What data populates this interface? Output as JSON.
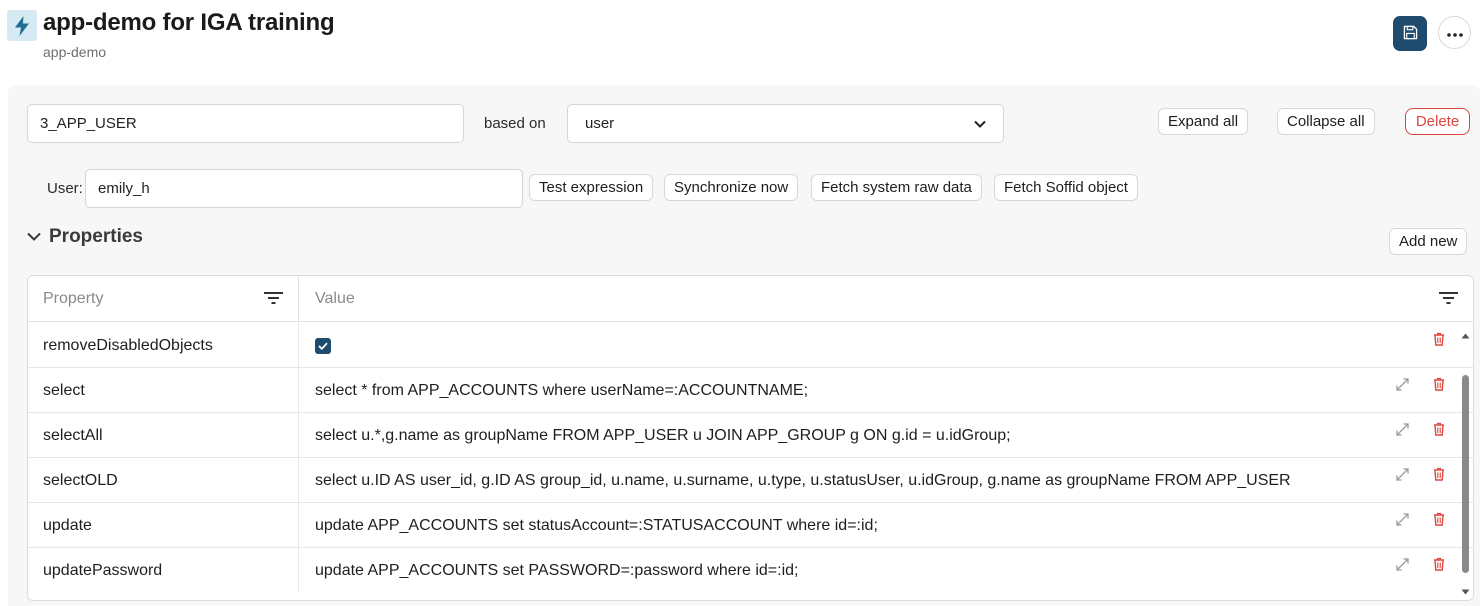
{
  "header": {
    "app_icon": "lightning-icon",
    "title": "app-demo for IGA training",
    "subtitle": "app-demo",
    "save_icon": "save-icon",
    "more_icon": "more-horizontal-icon"
  },
  "object_form": {
    "object_name": "3_APP_USER",
    "based_on_label": "based on",
    "based_on_value": "user",
    "expand_all": "Expand all",
    "collapse_all": "Collapse all",
    "delete": "Delete",
    "user_label": "User:",
    "user_value": "emily_h",
    "test_expression": "Test expression",
    "synchronize_now": "Synchronize now",
    "fetch_raw": "Fetch system raw data",
    "fetch_soffid": "Fetch Soffid object"
  },
  "properties": {
    "title": "Properties",
    "add_new": "Add new",
    "columns": [
      "Property",
      "Value"
    ],
    "rows": [
      {
        "property": "removeDisabledObjects",
        "value": "",
        "checked": true
      },
      {
        "property": "select",
        "value": "select * from APP_ACCOUNTS where userName=:ACCOUNTNAME;"
      },
      {
        "property": "selectAll",
        "value": "select u.*,g.name as groupName FROM APP_USER u JOIN APP_GROUP g ON g.id = u.idGroup;"
      },
      {
        "property": "selectOLD",
        "value": "select u.ID AS user_id, g.ID AS group_id, u.name, u.surname, u.type, u.statusUser, u.idGroup, g.name as groupName FROM APP_USER"
      },
      {
        "property": "update",
        "value": "update APP_ACCOUNTS set statusAccount=:STATUSACCOUNT where id=:id;"
      },
      {
        "property": "updatePassword",
        "value": "update APP_ACCOUNTS set PASSWORD=:password where id=:id;"
      }
    ]
  },
  "colors": {
    "primary": "#1f4b6e",
    "danger": "#e0453e",
    "icon_bg": "#d7eaf4"
  }
}
